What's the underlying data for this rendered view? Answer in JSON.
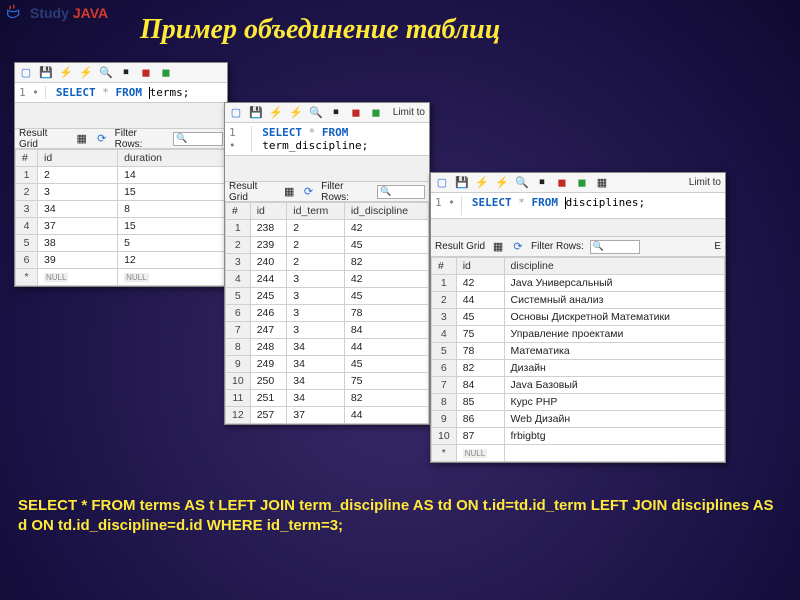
{
  "logo": {
    "text1": "Study",
    "text2": "JAVA"
  },
  "title": "Пример объединение таблиц",
  "bottom_sql": "SELECT * FROM terms AS t LEFT JOIN term_discipline AS td ON t.id=td.id_term LEFT JOIN disciplines AS d ON td.id_discipline=d.id WHERE id_term=3;",
  "labels": {
    "result_grid": "Result Grid",
    "filter_rows": "Filter Rows:",
    "limit": "Limit to",
    "line1": "1 •",
    "export": "E"
  },
  "keywords": {
    "select": "SELECT",
    "from": "FROM",
    "star": "*"
  },
  "win1": {
    "table_name": "terms;",
    "cols": [
      "#",
      "id",
      "duration"
    ],
    "rows": [
      [
        "1",
        "2",
        "14"
      ],
      [
        "2",
        "3",
        "15"
      ],
      [
        "3",
        "34",
        "8"
      ],
      [
        "4",
        "37",
        "15"
      ],
      [
        "5",
        "38",
        "5"
      ],
      [
        "6",
        "39",
        "12"
      ],
      [
        "*",
        "NULL",
        "NULL"
      ]
    ]
  },
  "win2": {
    "table_name": "term_discipline;",
    "cols": [
      "#",
      "id",
      "id_term",
      "id_discipline"
    ],
    "rows": [
      [
        "1",
        "238",
        "2",
        "42"
      ],
      [
        "2",
        "239",
        "2",
        "45"
      ],
      [
        "3",
        "240",
        "2",
        "82"
      ],
      [
        "4",
        "244",
        "3",
        "42"
      ],
      [
        "5",
        "245",
        "3",
        "45"
      ],
      [
        "6",
        "246",
        "3",
        "78"
      ],
      [
        "7",
        "247",
        "3",
        "84"
      ],
      [
        "8",
        "248",
        "34",
        "44"
      ],
      [
        "9",
        "249",
        "34",
        "45"
      ],
      [
        "10",
        "250",
        "34",
        "75"
      ],
      [
        "11",
        "251",
        "34",
        "82"
      ],
      [
        "12",
        "257",
        "37",
        "44"
      ]
    ]
  },
  "win3": {
    "table_name": "disciplines;",
    "cols": [
      "#",
      "id",
      "discipline"
    ],
    "rows": [
      [
        "1",
        "42",
        "Java Универсальный"
      ],
      [
        "2",
        "44",
        "Системный анализ"
      ],
      [
        "3",
        "45",
        "Основы Дискретной Математики"
      ],
      [
        "4",
        "75",
        "Управление проектами"
      ],
      [
        "5",
        "78",
        "Математика"
      ],
      [
        "6",
        "82",
        "Дизайн"
      ],
      [
        "7",
        "84",
        "Java Базовый"
      ],
      [
        "8",
        "85",
        "Курс PHP"
      ],
      [
        "9",
        "86",
        "Web Дизайн"
      ],
      [
        "10",
        "87",
        "frbigbtg"
      ],
      [
        "*",
        "NULL",
        ""
      ]
    ]
  }
}
